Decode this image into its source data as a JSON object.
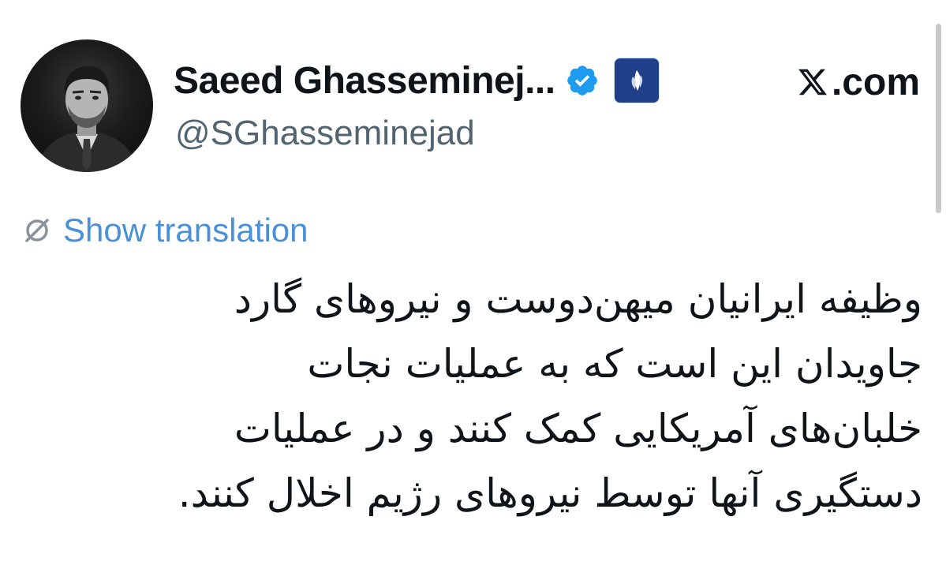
{
  "author": {
    "display_name": "Saeed Ghasseminej...",
    "handle": "@SGhasseminejad",
    "avatar_icon": "profile-photo",
    "verified_icon": "verified-badge-icon",
    "verified_color": "#1d9bf0",
    "affiliation_icon": "organization-affiliation-icon",
    "affiliation_color": "#1e3f8a"
  },
  "site": {
    "name": ".com",
    "logo_icon": "x-logo-icon"
  },
  "translation": {
    "icon": "globe-icon",
    "label": "Show translation",
    "color": "#4a90d9"
  },
  "tweet": {
    "lines": [
      "وظیفه ایرانیان میهن‌دوست و نیروهای گارد",
      "جاویدان این است که به عملیات نجات",
      "خلبان‌های آمریکایی کمک کنند و در عملیات",
      "دستگیری آنها توسط نیروهای رژیم اخلال کنند."
    ]
  }
}
